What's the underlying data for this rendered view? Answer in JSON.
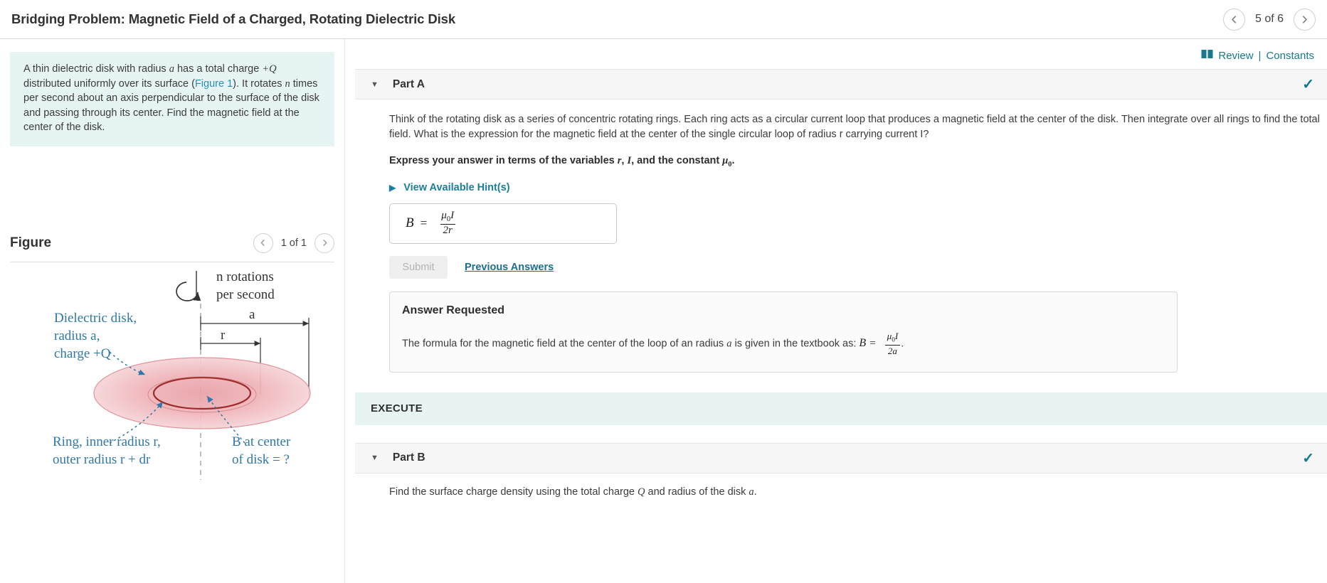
{
  "header": {
    "title": "Bridging Problem: Magnetic Field of a Charged, Rotating Dielectric Disk",
    "prev_icon": "chevron-left-icon",
    "next_icon": "chevron-right-icon",
    "pager_label": "5 of 6"
  },
  "left": {
    "problem_statement": {
      "part1": "A thin dielectric disk with radius ",
      "var_a": "a",
      "part2": " has a total charge ",
      "var_Q": "+Q",
      "part3": " distributed uniformly over its surface (",
      "figure_link": "Figure 1",
      "part4": "). It rotates ",
      "var_n": "n",
      "part5": " times per second about an axis perpendicular to the surface of the disk and passing through its center. Find the magnetic field at the center of the disk."
    },
    "figure": {
      "title": "Figure",
      "prev_icon": "chevron-left-icon",
      "next_icon": "chevron-right-icon",
      "pager_label": "1 of 1",
      "labels": {
        "rotations_line1": "n rotations",
        "rotations_line2": "per second",
        "disk_line1": "Dielectric disk,",
        "disk_line2": "radius a,",
        "disk_line3": "charge +Q",
        "ring_line1": "Ring, inner radius r,",
        "ring_line2": "outer radius r + dr",
        "b_line1": "B at center",
        "b_line2": "of disk = ?",
        "dim_a": "a",
        "dim_r": "r"
      }
    }
  },
  "right": {
    "review_icon": "book-icon",
    "review_label": "Review",
    "review_separator": "|",
    "constants_label": "Constants",
    "partA": {
      "caret_icon": "caret-down-icon",
      "title": "Part A",
      "check_icon": "checkmark-icon",
      "question_text": "Think of the rotating disk as a series of concentric rotating rings. Each ring acts as a circular current loop that produces a magnetic field at the center of the disk. Then integrate over all rings to find the total field. What is the expression for the magnetic field at the center of the single circular loop of radius r carrying current I?",
      "instruction_prefix": "Express your answer in terms of the variables ",
      "instruction_var1": "r",
      "instruction_comma": ", ",
      "instruction_var2": "I",
      "instruction_mid": ", and the constant ",
      "instruction_var3": "μ",
      "instruction_var3_sub": "0",
      "instruction_suffix": ".",
      "hints_caret_icon": "caret-right-icon",
      "hints_label": "View Available Hint(s)",
      "answer": {
        "lhs": "B",
        "equals": "=",
        "numerator_mu": "μ",
        "numerator_sub": "0",
        "numerator_I": "I",
        "denominator": "2r"
      },
      "submit_label": "Submit",
      "previous_answers_label": "Previous Answers",
      "answer_requested": {
        "title": "Answer Requested",
        "text_prefix": "The formula for the magnetic field at the center of the loop of an radius ",
        "var_a": "a",
        "text_mid": " is given in the textbook as: ",
        "eq_lhs": "B",
        "eq_equals": "=",
        "eq_num_mu": "μ",
        "eq_num_sub": "0",
        "eq_num_I": "I",
        "eq_den": "2a",
        "text_suffix": "."
      }
    },
    "execute_banner": "EXECUTE",
    "partB": {
      "caret_icon": "caret-down-icon",
      "title": "Part B",
      "check_icon": "checkmark-icon",
      "text_prefix": "Find the surface charge density using the total charge ",
      "var_Q": "Q",
      "text_mid": " and radius of the disk ",
      "var_a": "a",
      "text_suffix": "."
    }
  },
  "colors": {
    "accent_teal": "#19788e",
    "problem_bg": "#e7f4f4",
    "link_blue": "#1a6e8e",
    "figure_blue": "#2f78a8",
    "disk_pink": "#f0b8bc"
  }
}
